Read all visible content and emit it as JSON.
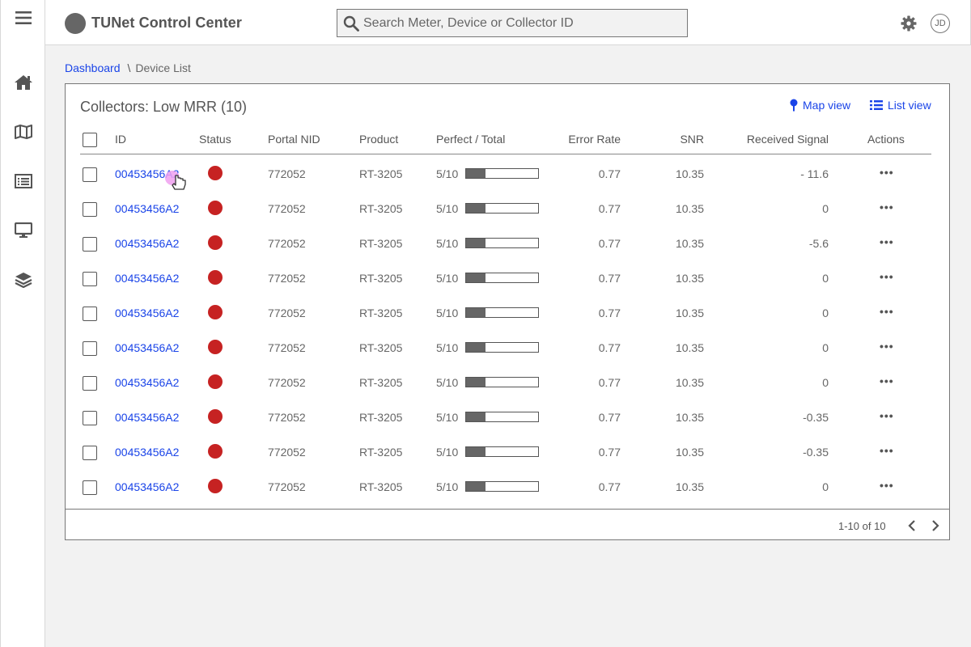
{
  "app": {
    "title": "TUNet Control Center"
  },
  "search": {
    "placeholder": "Search Meter, Device or Collector ID"
  },
  "user": {
    "initials": "JD"
  },
  "sidebar": {
    "icons": [
      "menu-icon",
      "home-icon",
      "map-icon",
      "list-icon",
      "monitor-icon",
      "layers-icon"
    ]
  },
  "breadcrumb": {
    "home": "Dashboard",
    "separator": "\\",
    "current": "Device List"
  },
  "panel": {
    "title": "Collectors: Low MRR (10)",
    "map_view": "Map view",
    "list_view": "List view"
  },
  "table": {
    "columns": {
      "id": "ID",
      "status": "Status",
      "portal_nid": "Portal NID",
      "product": "Product",
      "perfect_total": "Perfect / Total",
      "error_rate": "Error Rate",
      "snr": "SNR",
      "received_signal": "Received Signal",
      "actions": "Actions"
    },
    "rows": [
      {
        "id": "00453456A2",
        "portal_nid": "772052",
        "product": "RT-3205",
        "perfect_total": "5/10",
        "progress": 0.27,
        "error_rate": "0.77",
        "snr": "10.35",
        "received_signal": "- 11.6",
        "actions": "•••"
      },
      {
        "id": "00453456A2",
        "portal_nid": "772052",
        "product": "RT-3205",
        "perfect_total": "5/10",
        "progress": 0.27,
        "error_rate": "0.77",
        "snr": "10.35",
        "received_signal": "0",
        "actions": "•••"
      },
      {
        "id": "00453456A2",
        "portal_nid": "772052",
        "product": "RT-3205",
        "perfect_total": "5/10",
        "progress": 0.27,
        "error_rate": "0.77",
        "snr": "10.35",
        "received_signal": "-5.6",
        "actions": "•••"
      },
      {
        "id": "00453456A2",
        "portal_nid": "772052",
        "product": "RT-3205",
        "perfect_total": "5/10",
        "progress": 0.27,
        "error_rate": "0.77",
        "snr": "10.35",
        "received_signal": "0",
        "actions": "•••"
      },
      {
        "id": "00453456A2",
        "portal_nid": "772052",
        "product": "RT-3205",
        "perfect_total": "5/10",
        "progress": 0.27,
        "error_rate": "0.77",
        "snr": "10.35",
        "received_signal": "0",
        "actions": "•••"
      },
      {
        "id": "00453456A2",
        "portal_nid": "772052",
        "product": "RT-3205",
        "perfect_total": "5/10",
        "progress": 0.27,
        "error_rate": "0.77",
        "snr": "10.35",
        "received_signal": "0",
        "actions": "•••"
      },
      {
        "id": "00453456A2",
        "portal_nid": "772052",
        "product": "RT-3205",
        "perfect_total": "5/10",
        "progress": 0.27,
        "error_rate": "0.77",
        "snr": "10.35",
        "received_signal": "0",
        "actions": "•••"
      },
      {
        "id": "00453456A2",
        "portal_nid": "772052",
        "product": "RT-3205",
        "perfect_total": "5/10",
        "progress": 0.27,
        "error_rate": "0.77",
        "snr": "10.35",
        "received_signal": "-0.35",
        "actions": "•••"
      },
      {
        "id": "00453456A2",
        "portal_nid": "772052",
        "product": "RT-3205",
        "perfect_total": "5/10",
        "progress": 0.27,
        "error_rate": "0.77",
        "snr": "10.35",
        "received_signal": "-0.35",
        "actions": "•••"
      },
      {
        "id": "00453456A2",
        "portal_nid": "772052",
        "product": "RT-3205",
        "perfect_total": "5/10",
        "progress": 0.27,
        "error_rate": "0.77",
        "snr": "10.35",
        "received_signal": "0",
        "actions": "•••"
      }
    ]
  },
  "pagination": {
    "label": "1-10 of 10"
  },
  "colors": {
    "link": "#1a44e8",
    "status_error": "#c62222",
    "cursor_highlight": "#f0a0f0"
  }
}
